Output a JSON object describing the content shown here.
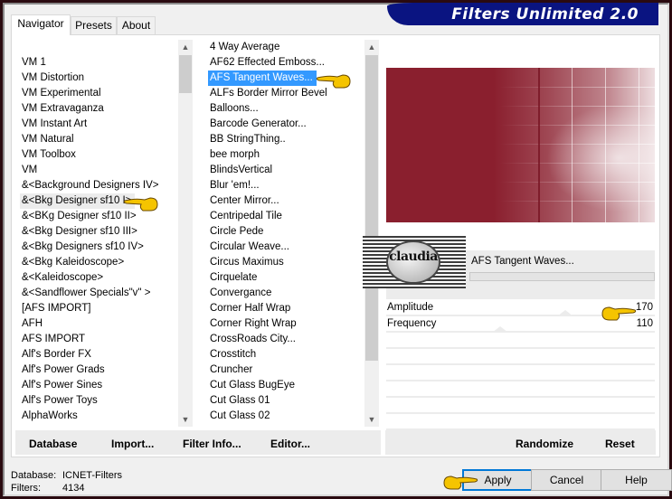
{
  "window": {
    "brand_title": "Filters Unlimited 2.0"
  },
  "tabs": [
    {
      "label": "Navigator",
      "active": true
    },
    {
      "label": "Presets",
      "active": false
    },
    {
      "label": "About",
      "active": false
    }
  ],
  "categories": {
    "items": [
      "VM 1",
      "VM Distortion",
      "VM Experimental",
      "VM Extravaganza",
      "VM Instant Art",
      "VM Natural",
      "VM Toolbox",
      "VM",
      "&<Background Designers IV>",
      "&<Bkg Designer sf10 I>",
      "&<BKg Designer sf10 II>",
      "&<Bkg Designer sf10 III>",
      "&<Bkg Designers sf10 IV>",
      "&<Bkg Kaleidoscope>",
      "&<Kaleidoscope>",
      "&<Sandflower Specials\"v\" >",
      "[AFS IMPORT]",
      "AFH",
      "AFS IMPORT",
      "Alf's Border FX",
      "Alf's Power Grads",
      "Alf's Power Sines",
      "Alf's Power Toys",
      "AlphaWorks"
    ],
    "highlighted": "&<Bkg Designer sf10 I>"
  },
  "filters": {
    "items": [
      "4 Way Average",
      "AF62 Effected Emboss...",
      "AFS Tangent Waves...",
      "ALFs Border Mirror Bevel",
      "Balloons...",
      "Barcode Generator...",
      "BB StringThing..",
      "bee morph",
      "BlindsVertical",
      "Blur 'em!...",
      "Center Mirror...",
      "Centripedal Tile",
      "Circle Pede",
      "Circular Weave...",
      "Circus Maximus",
      "Cirquelate",
      "Convergance",
      "Corner Half Wrap",
      "Corner Right Wrap",
      "CrossRoads City...",
      "Crosstitch",
      "Cruncher",
      "Cut Glass  BugEye",
      "Cut Glass 01",
      "Cut Glass 02"
    ],
    "selected": "AFS Tangent Waves..."
  },
  "preview": {
    "base_color": "#8a1f2e"
  },
  "filter_info": {
    "title": "AFS Tangent Waves...",
    "watermark": "claudia"
  },
  "parameters": [
    {
      "label": "Amplitude",
      "value": "170"
    },
    {
      "label": "Frequency",
      "value": "110"
    }
  ],
  "left_buttons": {
    "database": "Database",
    "import": "Import...",
    "filter_info": "Filter Info...",
    "editor": "Editor..."
  },
  "right_buttons": {
    "randomize": "Randomize",
    "reset": "Reset"
  },
  "status": {
    "database_label": "Database:",
    "database_value": "ICNET-Filters",
    "filters_label": "Filters:",
    "filters_value": "4134"
  },
  "dialog_buttons": {
    "apply": "Apply",
    "cancel": "Cancel",
    "help": "Help"
  },
  "icons": {
    "scroll_up": "▲",
    "scroll_down": "▼",
    "pointer_hand": "hand-pointer-icon"
  },
  "colors": {
    "brand_bg": "#0a1481",
    "selection": "#3399ff",
    "default_button_border": "#0078d7",
    "pointer_hand": "#f5c400"
  }
}
